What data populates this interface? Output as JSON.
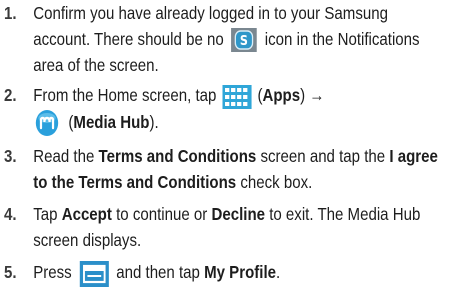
{
  "steps": [
    {
      "num": "1.",
      "p1": "Confirm you have already logged in to your Samsung account. There should be no",
      "icon": "samsung-account-icon",
      "p2": "icon in the Notifications area of the screen."
    },
    {
      "num": "2.",
      "p1": "From the Home screen, tap",
      "icon1": "apps-grid-icon",
      "p2": "(",
      "apps": "Apps",
      "p3": ") →",
      "icon2": "media-hub-icon",
      "p4": "(",
      "media_hub": "Media Hub",
      "p5": ")."
    },
    {
      "num": "3.",
      "p1": "Read the",
      "terms": "Terms and Conditions",
      "p2": "screen and tap the",
      "agree": "I agree to the Terms and Conditions",
      "p3": "check box."
    },
    {
      "num": "4.",
      "p1": "Tap",
      "accept": "Accept",
      "p2": "to continue or",
      "decline": "Decline",
      "p3": "to exit. The Media Hub screen displays."
    },
    {
      "num": "5.",
      "p1": "Press",
      "icon": "menu-key-icon",
      "p2": "and then tap",
      "my_profile": "My Profile",
      "p3": "."
    }
  ],
  "colors": {
    "samsung_icon_bg": "#7a8790",
    "samsung_icon_fg": "#2f97c9",
    "apps_icon": "#2fa6d8",
    "media_hub_icon": "#2aa0dc",
    "menu_icon": "#2b8fc9"
  }
}
